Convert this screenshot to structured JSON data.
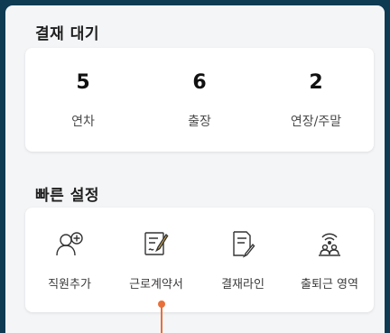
{
  "approval": {
    "title": "결재 대기",
    "stats": [
      {
        "value": "5",
        "label": "연차"
      },
      {
        "value": "6",
        "label": "출장"
      },
      {
        "value": "2",
        "label": "연장/주말"
      }
    ]
  },
  "quick_settings": {
    "title": "빠른 설정",
    "items": [
      {
        "label": "직원추가",
        "icon": "add-employee-icon"
      },
      {
        "label": "근로계약서",
        "icon": "contract-icon"
      },
      {
        "label": "결재라인",
        "icon": "approval-line-icon"
      },
      {
        "label": "출퇴근 영역",
        "icon": "commute-area-icon"
      }
    ]
  },
  "colors": {
    "background": "#0e3a52",
    "panel": "#f4f5f7",
    "card": "#ffffff",
    "pointer": "#e8703a"
  }
}
